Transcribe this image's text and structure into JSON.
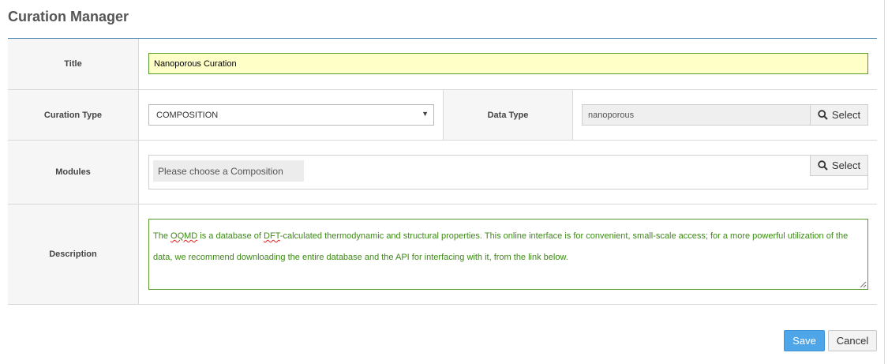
{
  "page": {
    "title": "Curation Manager"
  },
  "form": {
    "title": {
      "label": "Title",
      "value": "Nanoporous Curation"
    },
    "curation_type": {
      "label": "Curation Type",
      "selected": "COMPOSITION"
    },
    "data_type": {
      "label": "Data Type",
      "value": "nanoporous",
      "button_label": "Select",
      "button_icon": "search-icon"
    },
    "modules": {
      "label": "Modules",
      "chip": "Please choose a Composition",
      "button_label": "Select",
      "button_icon": "search-icon"
    },
    "description": {
      "label": "Description",
      "parts": [
        "The ",
        "OQMD",
        " is a database of ",
        "DFT",
        "-calculated thermodynamic and structural properties. This online interface is for convenient, small-scale access; for a more powerful utilization of the data, we recommend downloading the entire database and the API for interfacing with it, from the link below."
      ]
    }
  },
  "actions": {
    "save_label": "Save",
    "cancel_label": "Cancel"
  },
  "colors": {
    "accent_rule": "#3a7ea8",
    "title_input_bg": "#ffffc8",
    "valid_border": "#5a9a2a",
    "description_text": "#3c8a14",
    "save_button": "#4ea6e9"
  }
}
